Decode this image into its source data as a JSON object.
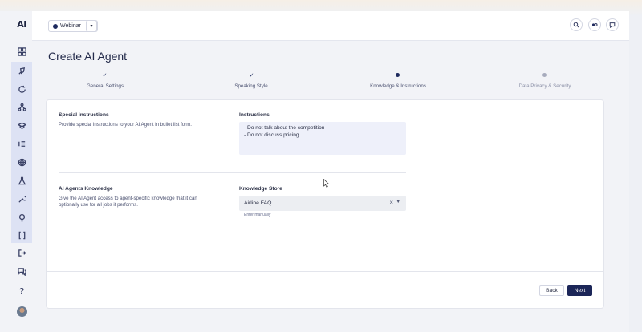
{
  "app": {
    "logo_text": "AI"
  },
  "header": {
    "workspace": "Webinar",
    "workspace_chevron": "▾",
    "icons": [
      "search-icon",
      "toggle-icon",
      "chat-icon"
    ]
  },
  "sidebar": {
    "icons": [
      "dashboard-icon",
      "rocket-icon",
      "refresh-icon",
      "network-icon",
      "graduation-cap-icon",
      "list-icon",
      "globe-icon",
      "flask-icon",
      "tools-icon",
      "lightbulb-icon",
      "code-bracket-icon",
      "logout-icon",
      "messages-icon",
      "help-icon",
      "avatar"
    ],
    "help_label": "?"
  },
  "page": {
    "title": "Create AI Agent"
  },
  "stepper": {
    "steps": [
      {
        "label": "General Settings",
        "state": "done",
        "mark": "✓"
      },
      {
        "label": "Speaking Style",
        "state": "done",
        "mark": "✓"
      },
      {
        "label": "Knowledge & Instructions",
        "state": "current",
        "mark": ""
      },
      {
        "label": "Data Privacy & Security",
        "state": "upcoming",
        "mark": ""
      }
    ],
    "colors": {
      "active": "#1e2a5e",
      "inactive": "#c4c7d4",
      "upcoming_dot": "#a7abbd"
    }
  },
  "special_instructions": {
    "title": "Special instructions",
    "description": "Provide special instructions to your AI Agent in bullet list form.",
    "field_label": "Instructions",
    "lines": [
      "- Do not talk about the competition",
      "- Do not discuss pricing"
    ]
  },
  "knowledge": {
    "title": "AI Agents Knowledge",
    "description_line1": "Give the AI Agent access to agent-specific knowledge that it can",
    "description_line2": "optionally use for all jobs it performs.",
    "field_label": "Knowledge Store",
    "value": "Airline FAQ",
    "clear": "×",
    "caret": "▼",
    "hint": "Enter manually"
  },
  "footer": {
    "back_label": "Back",
    "next_label": "Next"
  },
  "colors": {
    "primary": "#1c2658",
    "sidebar_highlight": "#dde2f4",
    "textarea_bg": "#eef0fa"
  }
}
